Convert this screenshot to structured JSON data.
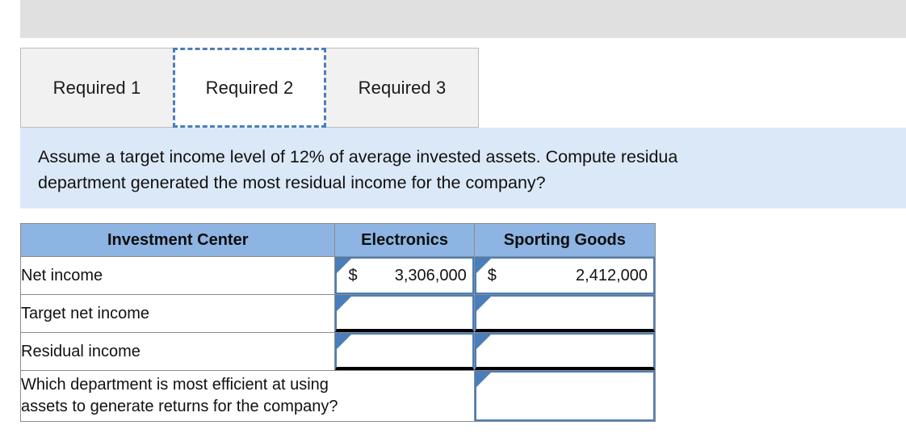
{
  "tabs": [
    {
      "label": "Required 1",
      "active": false
    },
    {
      "label": "Required 2",
      "active": true
    },
    {
      "label": "Required 3",
      "active": false
    }
  ],
  "instruction": {
    "line1": "Assume a target income level of 12% of average invested assets. Compute residua",
    "line2": "department generated the most residual income for the company?"
  },
  "table": {
    "headers": {
      "label": "Investment Center",
      "electronics": "Electronics",
      "sporting_goods": "Sporting Goods"
    },
    "rows": [
      {
        "label": "Net income",
        "electronics": {
          "currency": "$",
          "amount": "3,306,000",
          "filled": true
        },
        "sporting_goods": {
          "currency": "$",
          "amount": "2,412,000",
          "filled": true
        },
        "underlined": false
      },
      {
        "label": "Target net income",
        "electronics": {
          "currency": "",
          "amount": "",
          "filled": false
        },
        "sporting_goods": {
          "currency": "",
          "amount": "",
          "filled": false
        },
        "underlined": true
      },
      {
        "label": "Residual income",
        "electronics": {
          "currency": "",
          "amount": "",
          "filled": false
        },
        "sporting_goods": {
          "currency": "",
          "amount": "",
          "filled": false
        },
        "underlined": true
      }
    ],
    "question_row": {
      "label": "Which department is most efficient at using assets to generate returns for the company?",
      "label_line1": "Which department is most efficient at using",
      "label_line2": "assets to generate returns for the company?",
      "answer": ""
    }
  },
  "colors": {
    "header_blue": "#8db4e2",
    "panel_blue": "#dbe8f7",
    "input_border": "#4a7ebb",
    "top_bar_gray": "#e0e0e0",
    "tab_inactive": "#f1f1f1"
  }
}
